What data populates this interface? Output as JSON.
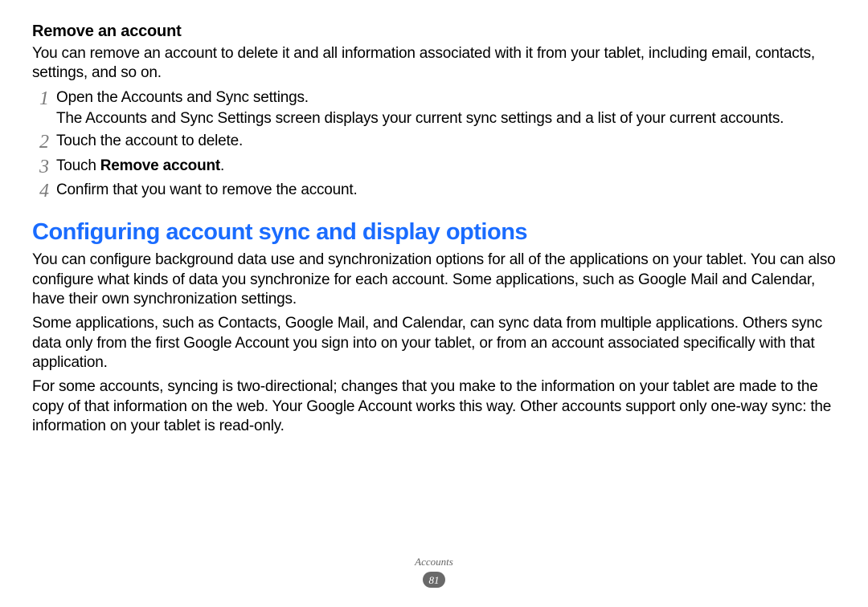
{
  "section_remove": {
    "title": "Remove an account",
    "intro": "You can remove an account to delete it and all information associated with it from your tablet, including email, contacts, settings, and so on.",
    "steps": [
      {
        "num": "1",
        "text": "Open the Accounts and Sync settings.",
        "sub": "The Accounts and Sync Settings screen displays your current sync settings and a list of your current accounts."
      },
      {
        "num": "2",
        "text": "Touch the account to delete."
      },
      {
        "num": "3",
        "text_prefix": "Touch ",
        "text_bold": "Remove account",
        "text_suffix": "."
      },
      {
        "num": "4",
        "text": "Confirm that you want to remove the account."
      }
    ]
  },
  "section_config": {
    "heading": "Configuring account sync and display options",
    "para1": "You can configure background data use and synchronization options for all of the applications on your tablet. You can also configure what kinds of data you synchronize for each account. Some applications, such as Google Mail and Calendar, have their own synchronization settings.",
    "para2": "Some applications, such as Contacts, Google Mail, and Calendar, can sync data from multiple applications. Others sync data only from the first Google Account you sign into on your tablet, or from an account associated specifically with that application.",
    "para3": "For some accounts, syncing is two-directional; changes that you make to the information on your tablet are made to the copy of that information on the web. Your Google Account works this way. Other accounts support only one-way sync: the information on your tablet is read-only."
  },
  "footer": {
    "chapter": "Accounts",
    "page": "81"
  }
}
